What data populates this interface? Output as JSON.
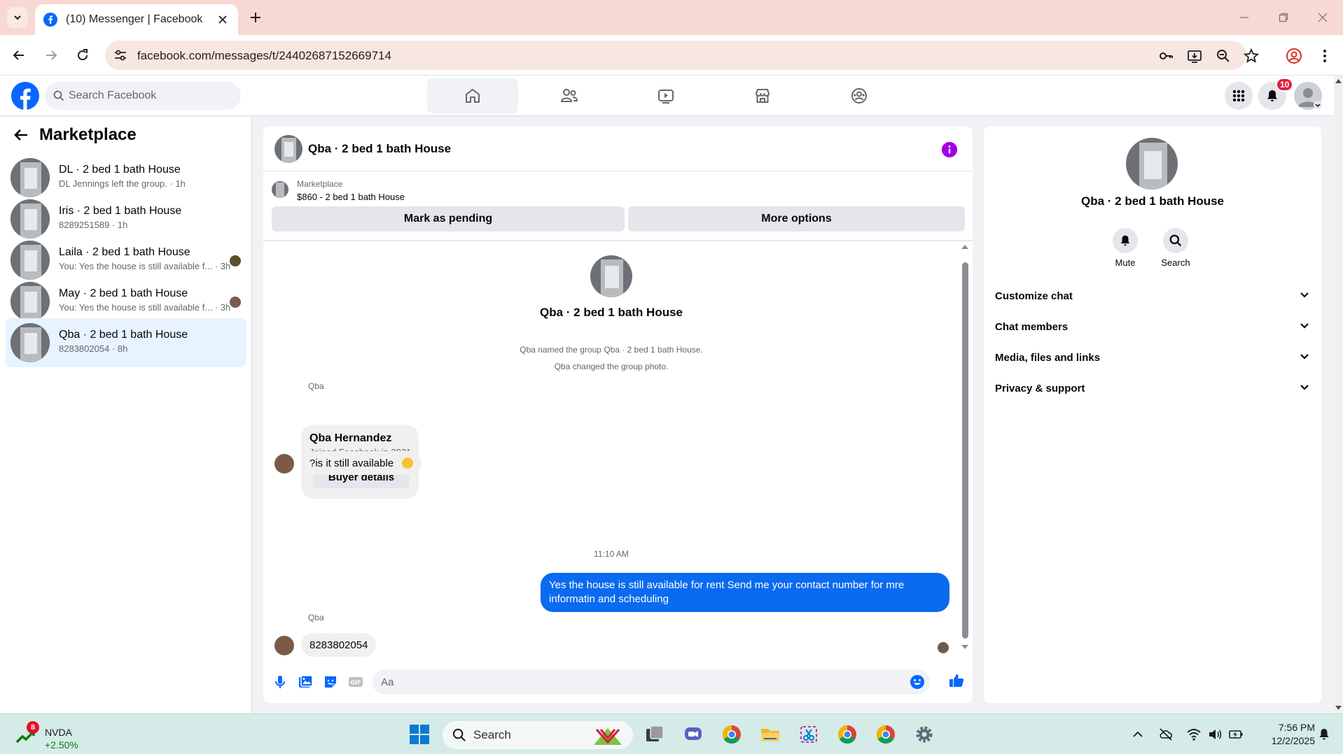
{
  "browser": {
    "tab_title": "(10) Messenger | Facebook",
    "url": "facebook.com/messages/t/24402687152669714"
  },
  "facebook": {
    "search_placeholder": "Search Facebook",
    "notification_count": "10",
    "brand_color": "#0866ff"
  },
  "sidebar": {
    "title": "Marketplace",
    "conversations": [
      {
        "name": "DL · 2 bed 1 bath House",
        "preview": "DL Jennings left the group. · 1h"
      },
      {
        "name": "Iris · 2 bed 1 bath House",
        "preview": "8289251589 · 1h"
      },
      {
        "name": "Laila · 2 bed 1 bath House",
        "preview": "You: Yes the house is still available f... · 3h"
      },
      {
        "name": "May · 2 bed 1 bath House",
        "preview": "You: Yes the house is still available f... · 3h"
      },
      {
        "name": "Qba · 2 bed 1 bath House",
        "preview": "8283802054 · 8h"
      }
    ]
  },
  "chat": {
    "title": "Qba · 2 bed 1 bath House",
    "marketplace_label": "Marketplace",
    "listing": "$860 - 2 bed 1 bath House",
    "mark_pending": "Mark as pending",
    "more_options": "More options",
    "intro_name": "Qba · 2 bed 1 bath House",
    "system_messages": [
      "Qba named the group Qba · 2 bed 1 bath House.",
      "Qba changed the group photo."
    ],
    "sender_name": "Qba",
    "profile_card": {
      "name": "Qba Hernandez",
      "joined": "Joined Facebook in 2021",
      "button": "Buyer details"
    },
    "incoming_1": "?is it still available",
    "time_separator": "11:10 AM",
    "outgoing_1": "Yes the house is still available for rent Send me your contact number for mre informatin and  scheduling",
    "incoming_2": "8283802054",
    "composer_placeholder": "Aa",
    "outgoing_color": "#0a6af0"
  },
  "info_panel": {
    "name": "Qba · 2 bed 1 bath House",
    "mute": "Mute",
    "search": "Search",
    "sections": [
      "Customize chat",
      "Chat members",
      "Media, files and links",
      "Privacy & support"
    ]
  },
  "taskbar": {
    "stock_name": "NVDA",
    "stock_change": "+2.50%",
    "stock_badge": "8",
    "search_placeholder": "Search",
    "time": "7:56 PM",
    "date": "12/2/2025"
  }
}
